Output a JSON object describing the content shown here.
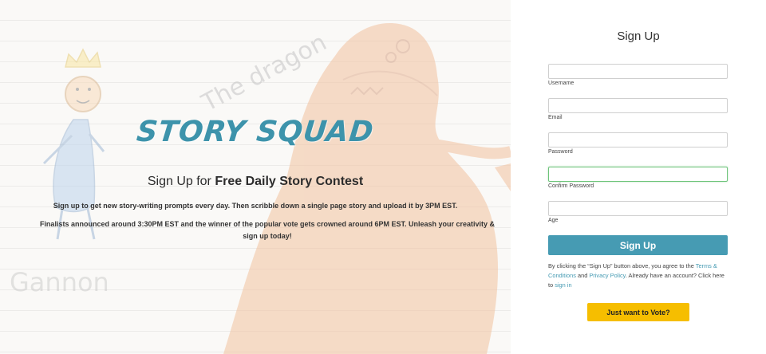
{
  "hero": {
    "logo_text": "STORY SQUAD",
    "heading_prefix": "Sign Up for ",
    "heading_bold": "Free Daily Story Contest",
    "paragraph_1": "Sign up to get new story-writing prompts every day. Then scribble down a single page story and upload it by 3PM EST.",
    "paragraph_2": "Finalists announced around 3:30PM EST and the winner of the popular vote gets crowned around 6PM EST. Unleash your creativity & sign up today!",
    "drawing": {
      "caption_dragon": "The dragon",
      "caption_name": "Gannon",
      "icons": [
        "crown-icon",
        "stick-figure-icon",
        "dragon-drawing"
      ]
    }
  },
  "form": {
    "title": "Sign Up",
    "fields": [
      {
        "label": "Username",
        "value": ""
      },
      {
        "label": "Email",
        "value": ""
      },
      {
        "label": "Password",
        "value": ""
      },
      {
        "label": "Confirm Password",
        "value": ""
      },
      {
        "label": "Age",
        "value": ""
      }
    ],
    "submit_label": "Sign Up",
    "terms": {
      "text_1": "By clicking the “Sign Up” button above, you agree to the ",
      "terms_link": "Terms & Conditions",
      "text_2": " and ",
      "privacy_link": "Privacy Policy",
      "text_3": ". Already have an account? Click here to ",
      "signin_link": "sign in"
    },
    "vote_label": "Just want to Vote?"
  },
  "colors": {
    "brand": "#3d93ab",
    "primary_button": "#469bb3",
    "vote_button": "#f6be00",
    "dragon": "#e8955a",
    "focus_border": "#6ec47a"
  }
}
